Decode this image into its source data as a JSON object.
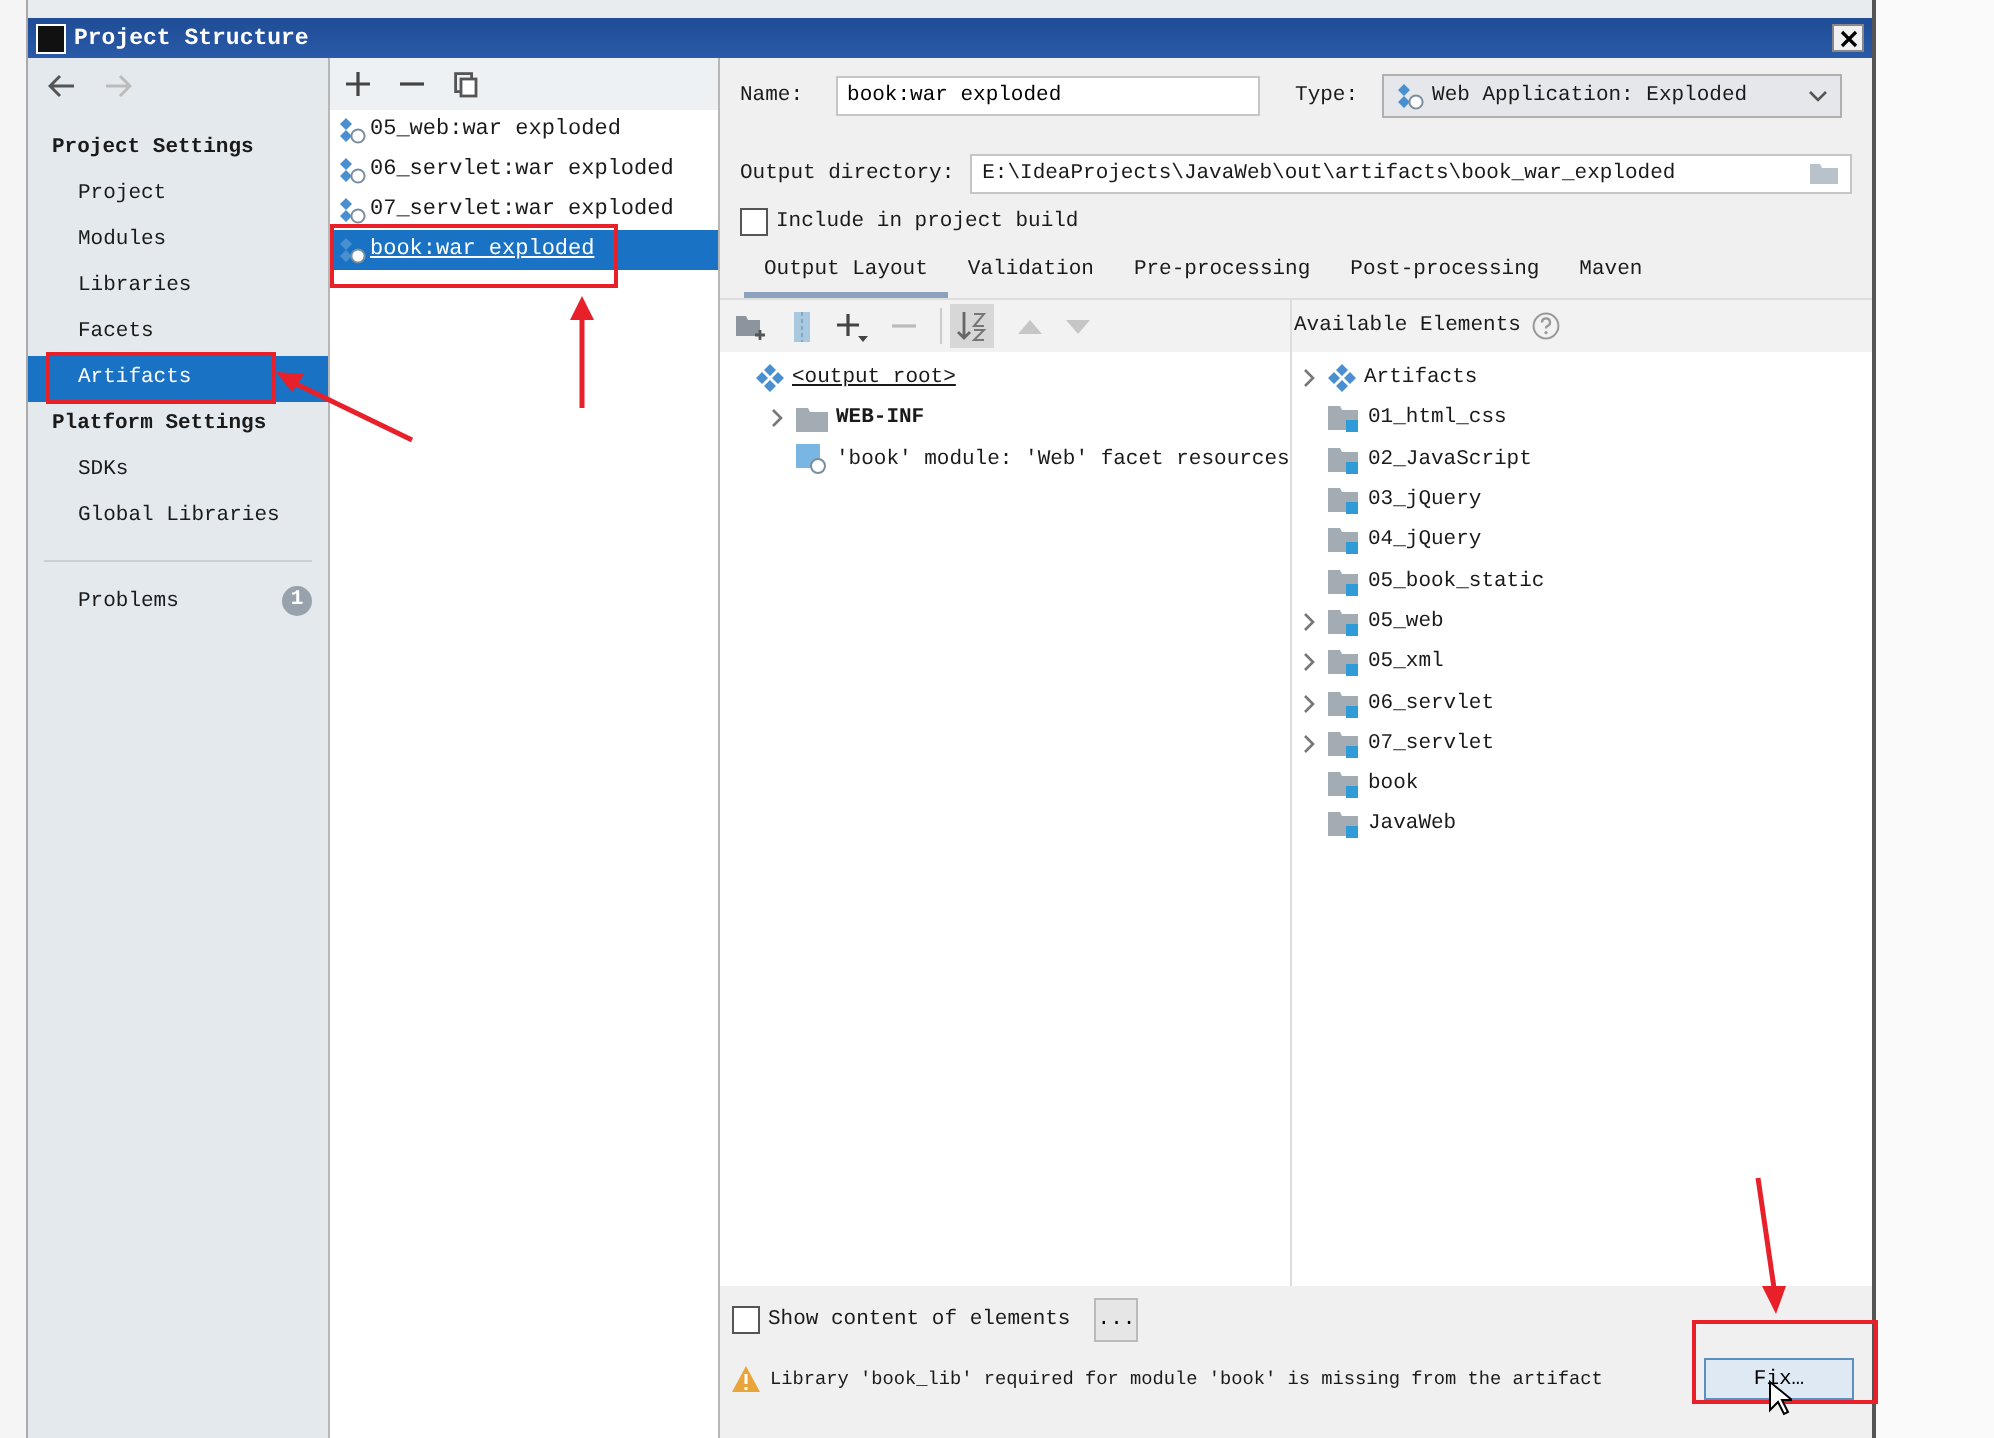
{
  "window": {
    "title": "Project Structure"
  },
  "sidebar": {
    "sections": [
      {
        "title": "Project Settings",
        "items": [
          {
            "label": "Project",
            "selected": false
          },
          {
            "label": "Modules",
            "selected": false
          },
          {
            "label": "Libraries",
            "selected": false
          },
          {
            "label": "Facets",
            "selected": false
          },
          {
            "label": "Artifacts",
            "selected": true
          }
        ]
      },
      {
        "title": "Platform Settings",
        "items": [
          {
            "label": "SDKs",
            "selected": false
          },
          {
            "label": "Global Libraries",
            "selected": false
          }
        ]
      }
    ],
    "problems": {
      "label": "Problems",
      "count": "1"
    }
  },
  "artifacts": [
    {
      "label": "05_web:war exploded",
      "selected": false
    },
    {
      "label": "06_servlet:war exploded",
      "selected": false
    },
    {
      "label": "07_servlet:war exploded",
      "selected": false
    },
    {
      "label": "book:war exploded",
      "selected": true
    }
  ],
  "form": {
    "name_label": "Name:",
    "name": "book:war exploded",
    "type_label": "Type:",
    "type": "Web Application: Exploded",
    "output_label": "Output directory:",
    "output_dir": "E:\\IdeaProjects\\JavaWeb\\out\\artifacts\\book_war_exploded",
    "include_label": "Include in project build",
    "include_checked": false
  },
  "tabs": [
    {
      "label": "Output Layout",
      "selected": true
    },
    {
      "label": "Validation",
      "selected": false
    },
    {
      "label": "Pre-processing",
      "selected": false
    },
    {
      "label": "Post-processing",
      "selected": false
    },
    {
      "label": "Maven",
      "selected": false
    }
  ],
  "output_tree": [
    {
      "label": "<output root>",
      "kind": "artifact",
      "expandable": false,
      "children": [
        {
          "label": "WEB-INF",
          "kind": "folder",
          "expandable": true
        },
        {
          "label": "'book' module: 'Web' facet resources",
          "kind": "module",
          "expandable": false
        }
      ]
    }
  ],
  "available": {
    "title": "Available Elements",
    "items": [
      {
        "label": "Artifacts",
        "kind": "artifact",
        "expandable": true
      },
      {
        "label": "01_html_css",
        "kind": "module",
        "expandable": false
      },
      {
        "label": "02_JavaScript",
        "kind": "module",
        "expandable": false
      },
      {
        "label": "03_jQuery",
        "kind": "module",
        "expandable": false
      },
      {
        "label": "04_jQuery",
        "kind": "module",
        "expandable": false
      },
      {
        "label": "05_book_static",
        "kind": "module",
        "expandable": false
      },
      {
        "label": "05_web",
        "kind": "module",
        "expandable": true
      },
      {
        "label": "05_xml",
        "kind": "module",
        "expandable": true
      },
      {
        "label": "06_servlet",
        "kind": "module",
        "expandable": true
      },
      {
        "label": "07_servlet",
        "kind": "module",
        "expandable": true
      },
      {
        "label": "book",
        "kind": "module",
        "expandable": false
      },
      {
        "label": "JavaWeb",
        "kind": "module",
        "expandable": false
      }
    ]
  },
  "show_content": {
    "label": "Show content of elements",
    "checked": false,
    "more": "..."
  },
  "warning": {
    "message": "Library 'book_lib' required for module 'book' is missing from the artifact",
    "fix": "Fix…"
  }
}
